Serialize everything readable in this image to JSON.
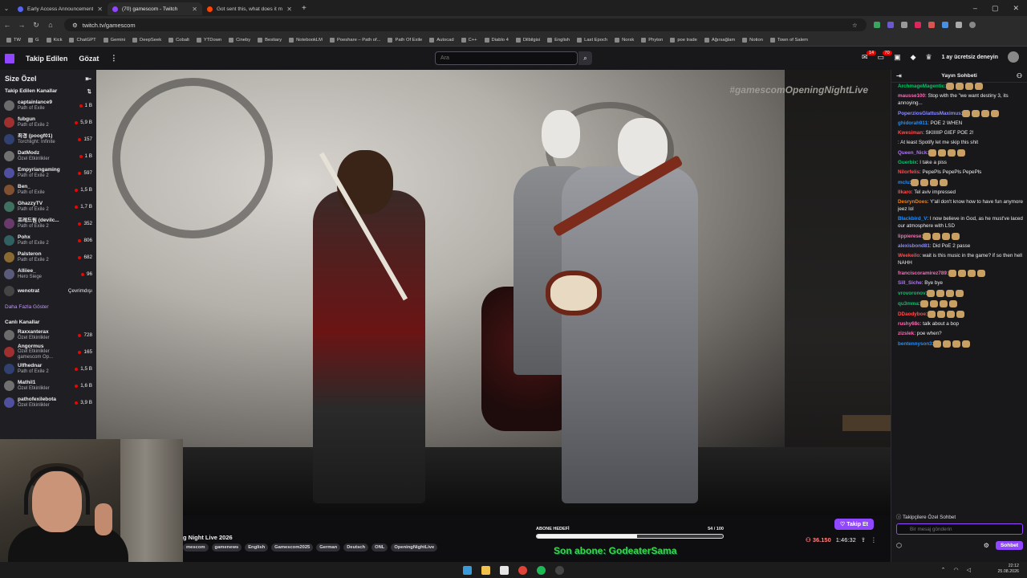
{
  "browser": {
    "tabs": [
      {
        "title": "Early Access Announcements",
        "color": "#5865f2"
      },
      {
        "title": "(70) gamescom - Twitch",
        "color": "#9147ff"
      },
      {
        "title": "Got sent this, what does it mea",
        "color": "#ff4500"
      }
    ],
    "url": "twitch.tv/gamescom",
    "bookmarks": [
      "TW",
      "G",
      "Kick",
      "ChatGPT",
      "Gemini",
      "DeepSeek",
      "Cobalt",
      "YTDown",
      "Cineby",
      "Bestiary",
      "NotebookLM",
      "Poeshare – Path of...",
      "Path Of Exile",
      "Autocad",
      "C++",
      "Diablo 4",
      "Dilbilgisi",
      "English",
      "Last Epoch",
      "Norsk",
      "Phyton",
      "poe trade",
      "Ağırsağlam",
      "Notion",
      "Town of Salem"
    ]
  },
  "nav": {
    "following": "Takip Edilen",
    "browse": "Gözat",
    "search_placeholder": "Ara",
    "notif_count_1": "14",
    "notif_count_2": "70",
    "prime_text": "1 ay ücretsiz deneyin"
  },
  "sidebar": {
    "title": "Size Özel",
    "followed_heading": "Takip Edilen Kanallar",
    "followed": [
      {
        "name": "captainlance9",
        "game": "Path of Exile",
        "viewers": "1 B"
      },
      {
        "name": "fubgun",
        "game": "Path of Exile 2",
        "viewers": "5,9 B"
      },
      {
        "name": "최경 (poogf01)",
        "game": "Torchlight: Infinite",
        "viewers": "157"
      },
      {
        "name": "DatModz",
        "game": "Özel Etkinlikler",
        "viewers": "1 B"
      },
      {
        "name": "Empyriangaming",
        "game": "Path of Exile 2",
        "viewers": "597"
      },
      {
        "name": "Ben_",
        "game": "Path of Exile",
        "viewers": "1,5 B"
      },
      {
        "name": "GhazzyTV",
        "game": "Path of Exile 2",
        "viewers": "1,7 B"
      },
      {
        "name": "프레드림 (devilc...",
        "game": "Path of Exile 2",
        "viewers": "352"
      },
      {
        "name": "Pohx",
        "game": "Path of Exile 2",
        "viewers": "806"
      },
      {
        "name": "Palsteron",
        "game": "Path of Exile 2",
        "viewers": "682"
      },
      {
        "name": "Alliiee_",
        "game": "Hero Siege",
        "viewers": "96"
      },
      {
        "name": "wenotrat",
        "game": "",
        "viewers": "Çevrimdışı"
      }
    ],
    "show_more": "Daha Fazla Göster",
    "live_heading": "Canlı Kanallar",
    "live": [
      {
        "name": "Raxxanterax",
        "game": "Özel Etkinlikler",
        "viewers": "728"
      },
      {
        "name": "Angormus",
        "game": "Özel Etkinlikler",
        "extra": "gamescom Op...",
        "viewers": "165"
      },
      {
        "name": "Ulfhednar",
        "game": "Path of Exile 2",
        "viewers": "1,5 B"
      },
      {
        "name": "Mathil1",
        "game": "Özel Etkinlikler",
        "viewers": "1,6 B"
      },
      {
        "name": "pathofexilebota",
        "game": "Özel Etkinlikler",
        "viewers": "3,9 B"
      }
    ]
  },
  "video": {
    "hashtag": "#gamescomOpeningNightLive"
  },
  "info": {
    "title": "g Night Live 2026",
    "tags": [
      "mescom",
      "gamenews",
      "English",
      "Gamescom2025",
      "German",
      "Deutsch",
      "ONL",
      "OpeningNightLive"
    ],
    "goal_label": "ABONE HEDEFİ",
    "goal_count": "54 / 100",
    "goal_fraction": 0.54,
    "last_sub": "Son abone: GodeaterSama",
    "follow_btn": "Takip Et",
    "viewers": "36.150",
    "uptime": "1:46:32"
  },
  "chat": {
    "title": "Yayın Sohbeti",
    "messages": [
      {
        "user": "ArchmageMagentic",
        "color": "#00c46a",
        "text": ":"
      },
      {
        "user": "mausse100",
        "color": "#ff69b4",
        "text": ": Stop with the \"we want destiny 3, its annoying..."
      },
      {
        "user": "PoperziosGlattusMaximus",
        "color": "#8a8aff",
        "text": ":"
      },
      {
        "user": "ghidorah911",
        "color": "#1e90ff",
        "text": ": POE 2 WHEN"
      },
      {
        "user": "Kwesiman",
        "color": "#ff4d4d",
        "text": ": SKIIIIIP GIEF POE 2!"
      },
      {
        "user": "",
        "color": "#1e90ff",
        "text": ": At least Spotify let me skip this shit"
      },
      {
        "user": "Queen_Nick",
        "color": "#b070ff",
        "text": ":"
      },
      {
        "user": "Guerbix",
        "color": "#00c46a",
        "text": ": I take a piss"
      },
      {
        "user": "Nilorfelis",
        "color": "#ff4d4d",
        "text": ": PepePls PepePls PepePls"
      },
      {
        "user": "mclu",
        "color": "#1e90ff",
        "text": ":"
      },
      {
        "user": "Ilkaro",
        "color": "#ff4d4d",
        "text": ": Tel aviv impressed"
      },
      {
        "user": "DesrynDoes",
        "color": "#ff7f00",
        "text": ": Y'all don't know how to have fun anymore jeez lol"
      },
      {
        "user": "Blackbird_V",
        "color": "#1e90ff",
        "text": ": I now believe in God, as he must've laced our atmosphere with LSD"
      },
      {
        "user": "lippierese",
        "color": "#ff69b4",
        "text": ":"
      },
      {
        "user": "alexisbond81",
        "color": "#8a8aff",
        "text": ": Did PoE 2 passe"
      },
      {
        "user": "Weekeilo",
        "color": "#ff4d4d",
        "text": ": wait is this music in the game? if so then hell NAHH"
      },
      {
        "user": "franciscoramirez789",
        "color": "#ff69b4",
        "text": ":"
      },
      {
        "user": "Sill_Siche",
        "color": "#b070ff",
        "text": ": Bye bye"
      },
      {
        "user": "vrovoronov",
        "color": "#00c46a",
        "text": ":"
      },
      {
        "user": "qu3mma",
        "color": "#00c46a",
        "text": ":"
      },
      {
        "user": "DDaodyboe",
        "color": "#ff4d4d",
        "text": ":"
      },
      {
        "user": "rushy68c",
        "color": "#ff69b4",
        "text": ": talk about a bop"
      },
      {
        "user": "zizslek",
        "color": "#ff69b4",
        "text": ": poe when?"
      },
      {
        "user": "bentennyson3",
        "color": "#1e90ff",
        "text": ":"
      }
    ],
    "follower_only": "Takipçilere Özel Sohbet",
    "input_placeholder": "Bir mesaj gönderin",
    "send_btn": "Sohbet"
  },
  "taskbar": {
    "time": "22:12",
    "date": "25.08.2026"
  }
}
